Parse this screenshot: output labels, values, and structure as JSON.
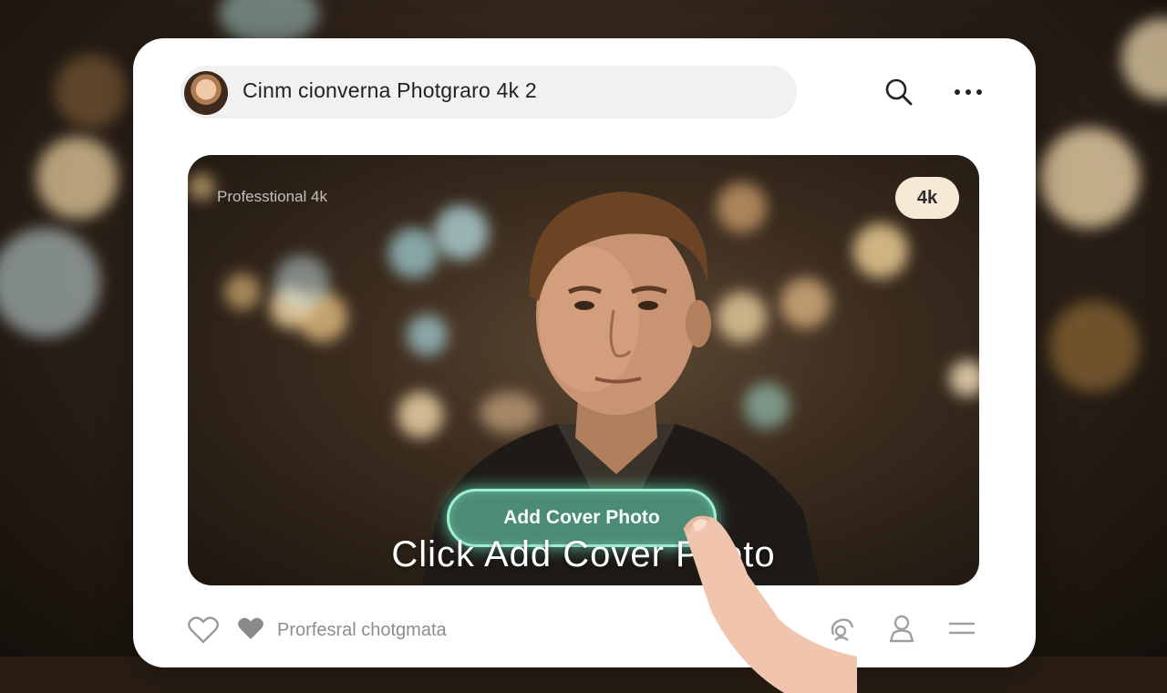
{
  "header": {
    "title": "Cinm cionverna Photgraro 4k 2",
    "search_icon": "search-icon",
    "more_icon": "more-horizontal-icon"
  },
  "hero": {
    "label": "Professtional 4k",
    "badge": "4k",
    "cover_button": "Add Cover Photo"
  },
  "caption": "Click Add Cover Photo",
  "footer": {
    "text": "Prorfesral chotgmata",
    "icons": [
      "heart-outline-icon",
      "heart-filled-icon",
      "share-icon",
      "user-icon",
      "menu-icon"
    ]
  },
  "colors": {
    "accent_button": "#4c8b75",
    "accent_glow": "#9ff0d2",
    "card_bg": "#ffffff"
  }
}
